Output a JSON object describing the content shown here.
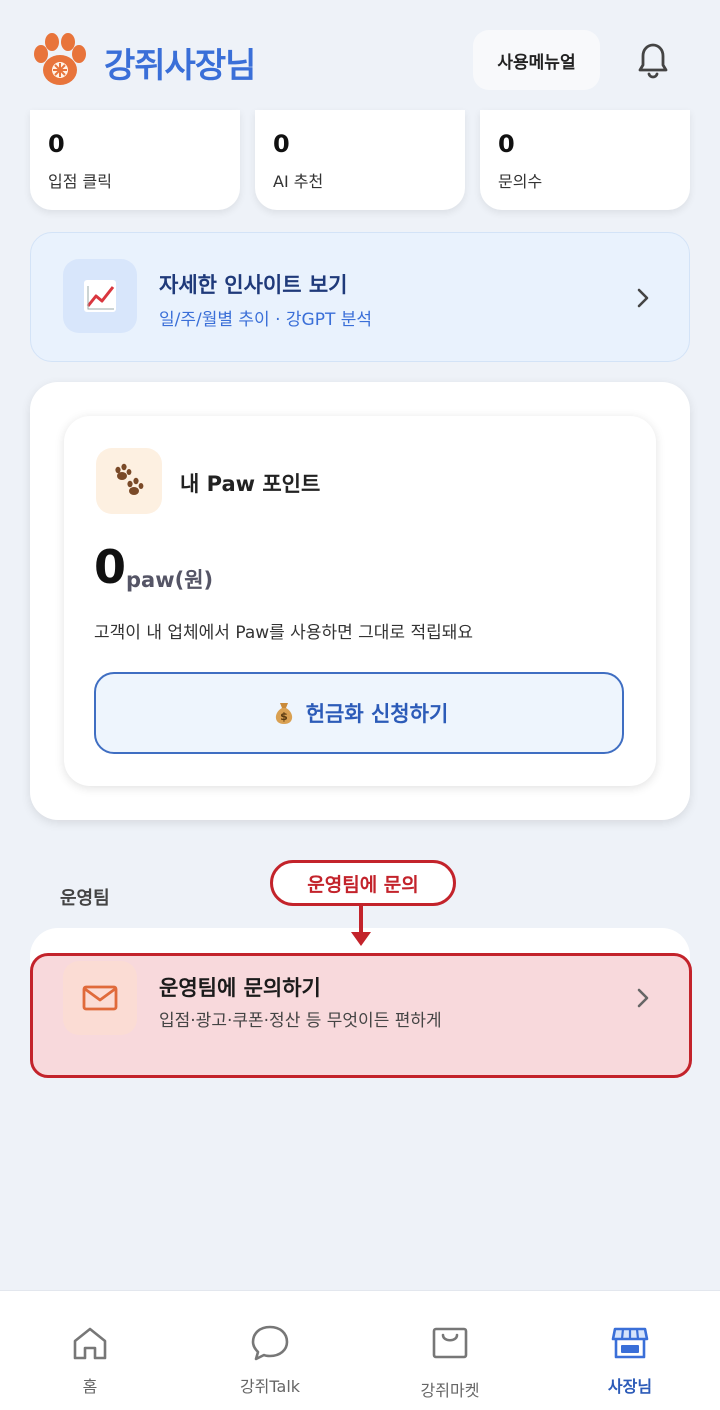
{
  "header": {
    "app_title": "강쥐사장님",
    "manual_label": "사용메뉴얼",
    "logo_icon": "paw-logo-icon",
    "bell_icon": "bell-icon"
  },
  "stats": [
    {
      "value": "0",
      "label": "입점 클릭"
    },
    {
      "value": "0",
      "label": "AI 추천"
    },
    {
      "value": "0",
      "label": "문의수"
    }
  ],
  "insight": {
    "title": "자세한 인사이트 보기",
    "subtitle": "일/주/월별 추이 · 강GPT 분석",
    "icon": "chart-up-icon"
  },
  "paw": {
    "title": "내 Paw 포인트",
    "amount": "0",
    "unit": "paw(원)",
    "description": "고객이 내 업체에서 Paw를 사용하면 그대로 적립돼요",
    "cash_button": "헌금화 신청하기",
    "cash_icon": "money-bag-icon",
    "icon": "paw-prints-icon"
  },
  "ops": {
    "section_label": "운영팀",
    "callout": "운영팀에 문의",
    "title": "운영팀에 문의하기",
    "subtitle": "입점·광고·쿠폰·정산 등 무엇이든 편하게",
    "icon": "mail-icon"
  },
  "nav": [
    {
      "label": "홈",
      "icon": "home-icon"
    },
    {
      "label": "강쥐Talk",
      "icon": "chat-bubble-icon"
    },
    {
      "label": "강쥐마켓",
      "icon": "shopping-bag-icon"
    },
    {
      "label": "사장님",
      "icon": "store-icon"
    }
  ],
  "colors": {
    "brand_blue": "#3a6fd8",
    "highlight_red": "#c3232b",
    "background": "#eef2f8"
  }
}
